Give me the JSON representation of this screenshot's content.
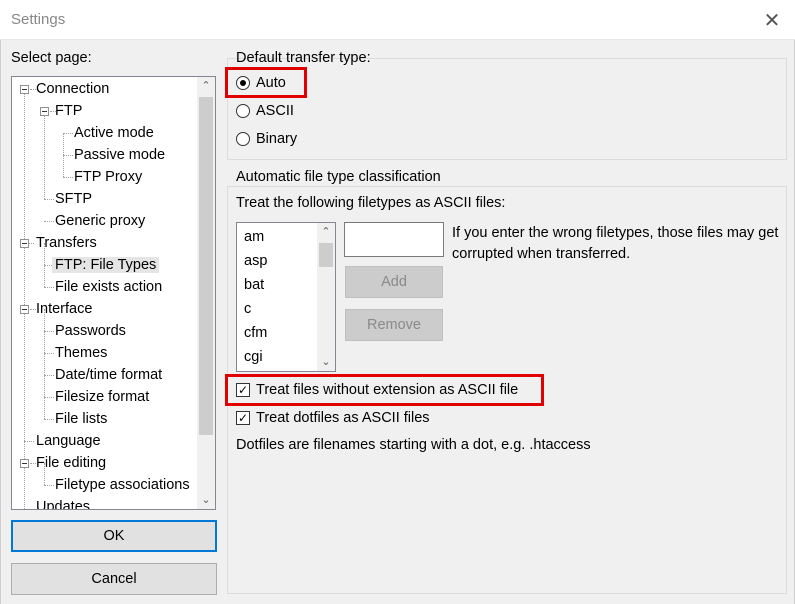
{
  "window": {
    "title": "Settings",
    "close_glyph": "✕"
  },
  "sidebar": {
    "label": "Select page:",
    "tree": [
      {
        "label": "Connection"
      },
      {
        "label": "FTP"
      },
      {
        "label": "Active mode"
      },
      {
        "label": "Passive mode"
      },
      {
        "label": "FTP Proxy"
      },
      {
        "label": "SFTP"
      },
      {
        "label": "Generic proxy"
      },
      {
        "label": "Transfers"
      },
      {
        "label": "FTP: File Types"
      },
      {
        "label": "File exists action"
      },
      {
        "label": "Interface"
      },
      {
        "label": "Passwords"
      },
      {
        "label": "Themes"
      },
      {
        "label": "Date/time format"
      },
      {
        "label": "Filesize format"
      },
      {
        "label": "File lists"
      },
      {
        "label": "Language"
      },
      {
        "label": "File editing"
      },
      {
        "label": "Filetype associations"
      },
      {
        "label": "Updates"
      }
    ],
    "selected": "FTP: File Types",
    "ok_label": "OK",
    "cancel_label": "Cancel"
  },
  "transfer_type": {
    "title": "Default transfer type:",
    "options": [
      {
        "label": "Auto",
        "checked": true
      },
      {
        "label": "ASCII",
        "checked": false
      },
      {
        "label": "Binary",
        "checked": false
      }
    ]
  },
  "classification": {
    "title": "Automatic file type classification",
    "subtitle": "Treat the following filetypes as ASCII files:",
    "filetypes": [
      "am",
      "asp",
      "bat",
      "c",
      "cfm",
      "cgi"
    ],
    "input_value": "",
    "hint": "If you enter the wrong filetypes, those files may get corrupted when transferred.",
    "add_label": "Add",
    "remove_label": "Remove",
    "no_ext_label": "Treat files without extension as ASCII file",
    "no_ext_checked": true,
    "dotfiles_label": "Treat dotfiles as ASCII files",
    "dotfiles_checked": true,
    "dotfiles_note": "Dotfiles are filenames starting with a dot, e.g. .htaccess"
  },
  "highlight_color": "#e00000",
  "icons": {
    "checkmark": "✓",
    "scroll_up": "⌃",
    "scroll_down": "⌄"
  }
}
